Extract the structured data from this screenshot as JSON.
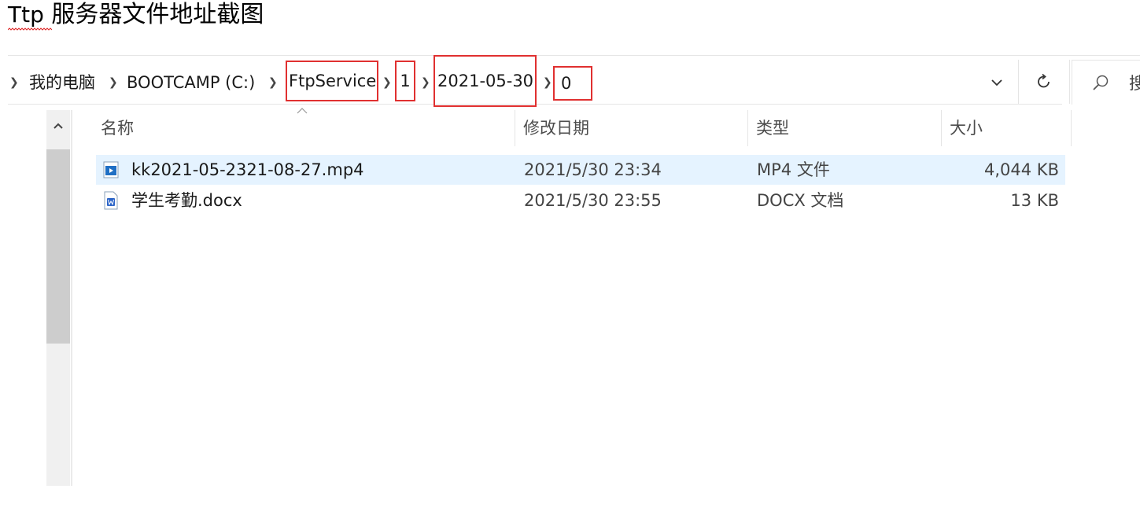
{
  "doc": {
    "title_latin": "Ttp",
    "title_cjk": " 服务器文件地址截图"
  },
  "breadcrumb": {
    "items": [
      "我的电脑",
      "BOOTCAMP (C:)",
      "FtpService",
      "1",
      "2021-05-30",
      "0"
    ],
    "separator": "›"
  },
  "search": {
    "placeholder": "搜"
  },
  "columns": {
    "name": "名称",
    "modified": "修改日期",
    "type": "类型",
    "size": "大小"
  },
  "files": [
    {
      "name": "kk2021-05-2321-08-27.mp4",
      "modified": "2021/5/30 23:34",
      "type": "MP4 文件",
      "size": "4,044 KB",
      "icon": "video-file-icon",
      "selected": true
    },
    {
      "name": "学生考勤.docx",
      "modified": "2021/5/30 23:55",
      "type": "DOCX 文档",
      "size": "13 KB",
      "icon": "word-document-icon",
      "selected": false
    }
  ],
  "colors": {
    "highlight_box": "#e03030",
    "selected_row": "#e5f3ff",
    "scroll_thumb": "#cdcdcd"
  }
}
